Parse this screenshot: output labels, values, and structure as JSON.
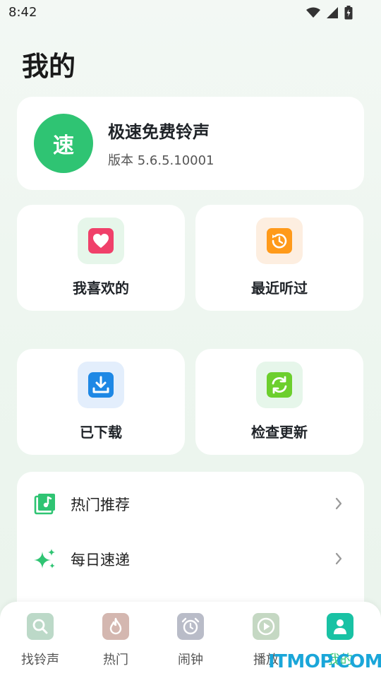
{
  "status_bar": {
    "time": "8:42"
  },
  "page": {
    "title": "我的"
  },
  "app_info": {
    "logo_char": "速",
    "name": "极速免费铃声",
    "version": "版本 5.6.5.10001"
  },
  "tiles": {
    "favorites": "我喜欢的",
    "recent": "最近听过",
    "downloaded": "已下载",
    "update": "检查更新"
  },
  "list": {
    "hot_recommend": "热门推荐",
    "daily_express": "每日速递"
  },
  "tabs": {
    "find": "找铃声",
    "hot": "热门",
    "alarm": "闹钟",
    "play": "播放",
    "mine": "我的"
  },
  "watermark": "ITMOP.COM",
  "colors": {
    "accent": "#2fc473",
    "heart": "#f0406a",
    "history": "#ff9a1a",
    "download": "#1e88e5",
    "refresh": "#6ccf2d"
  }
}
